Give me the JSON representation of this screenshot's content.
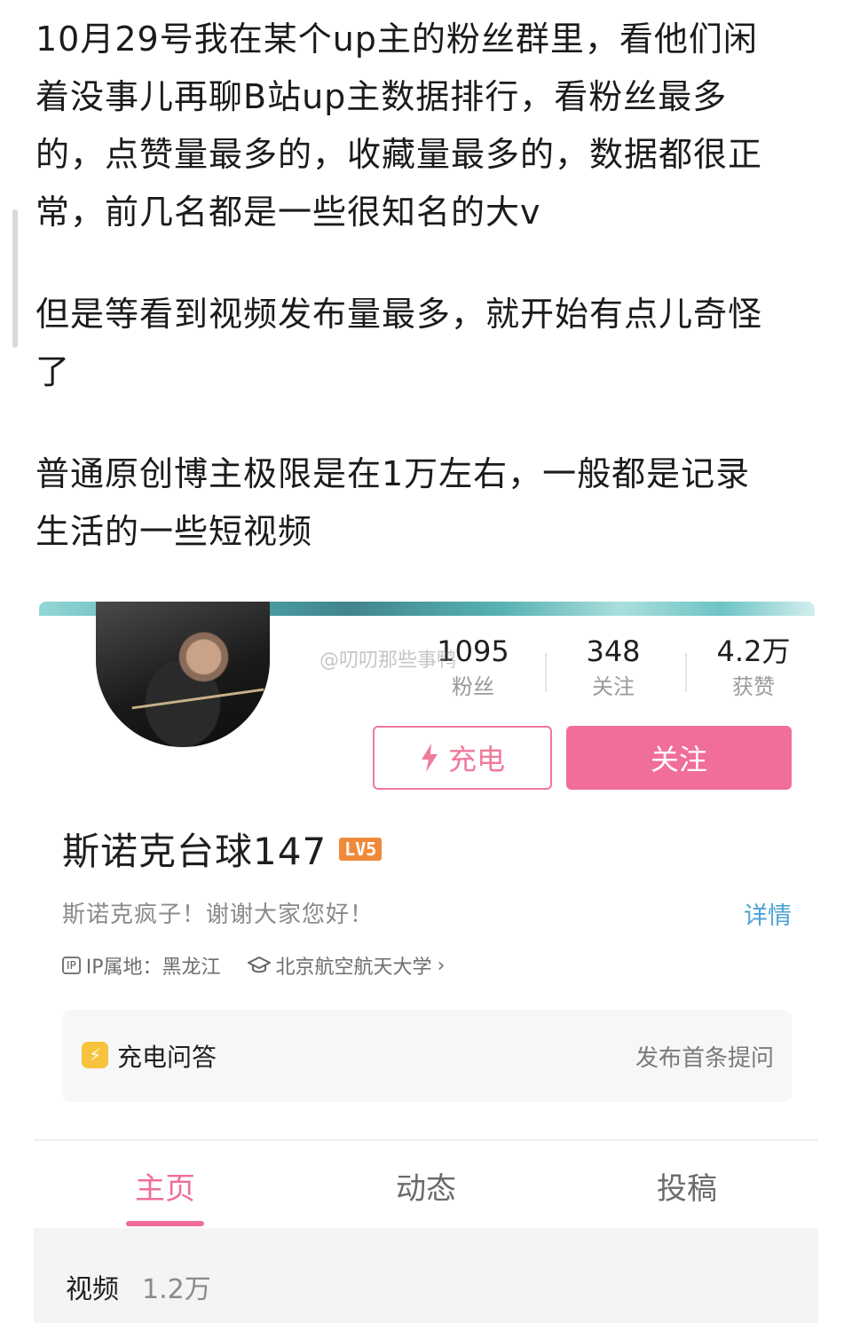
{
  "post": {
    "paragraphs": [
      [
        "10月29号我在某个up主的粉丝群里，看他们闲",
        "着没事儿再聊B站up主数据排行，看粉丝最多",
        "的，点赞量最多的，收藏量最多的，数据都很正",
        "常，前几名都是一些很知名的大v"
      ],
      [
        "但是等看到视频发布量最多，就开始有点儿奇怪",
        "了"
      ],
      [
        "普通原创博主极限是在1万左右，一般都是记录",
        "生活的一些短视频"
      ]
    ]
  },
  "profile": {
    "stats": [
      {
        "value": "1095",
        "label": "粉丝"
      },
      {
        "value": "348",
        "label": "关注"
      },
      {
        "value": "4.2万",
        "label": "获赞"
      }
    ],
    "watermark": "@叨叨那些事鸭",
    "charge_button": "充电",
    "follow_button": "关注",
    "name": "斯诺克台球147",
    "level_badge": "LV5",
    "bio": "斯诺克疯子！谢谢大家您好！",
    "detail_link": "详情",
    "ip_icon": "IP",
    "ip_location": "IP属地：黑龙江",
    "school": "北京航空航天大学",
    "school_chevron": "›",
    "qa": {
      "label": "充电问答",
      "action": "发布首条提问"
    },
    "tabs": [
      {
        "label": "主页",
        "active": true
      },
      {
        "label": "动态",
        "active": false
      },
      {
        "label": "投稿",
        "active": false
      }
    ],
    "videos": {
      "label": "视频",
      "count": "1.2万"
    }
  },
  "colors": {
    "accent_pink": "#f06e98",
    "link_blue": "#4aa3d6",
    "level_orange": "#f08a3a",
    "qa_yellow": "#f7c33c"
  },
  "icons": {
    "charge": "lightning-icon",
    "ip": "ip-icon",
    "school": "graduation-cap-icon",
    "qa": "lightning-badge-icon"
  }
}
